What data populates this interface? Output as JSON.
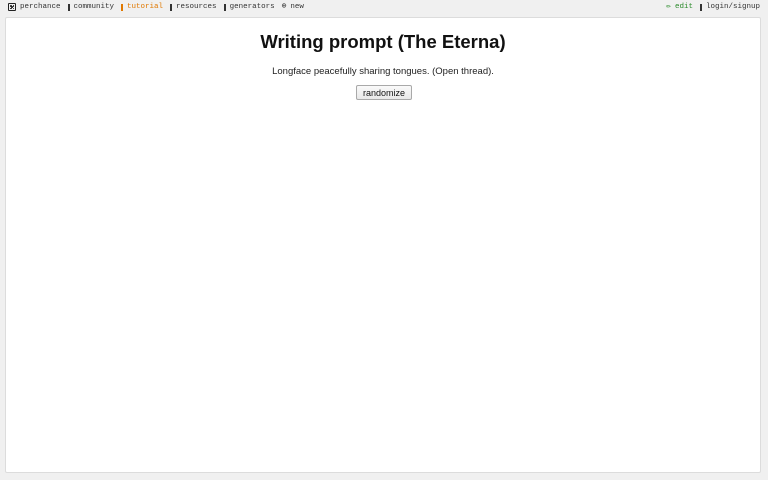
{
  "nav": {
    "items": [
      {
        "label": "perchance",
        "icon": "dice-icon"
      },
      {
        "label": "community",
        "icon": "community-icon"
      },
      {
        "label": "tutorial",
        "icon": "tutorial-icon"
      },
      {
        "label": "resources",
        "icon": "resources-icon"
      },
      {
        "label": "generators",
        "icon": "generators-icon"
      },
      {
        "label": "new",
        "icon": "plus-circle-icon"
      }
    ],
    "edit_label": "edit",
    "edit_icon": "pencil-icon",
    "login_label": "login/signup",
    "login_icon": "user-icon"
  },
  "colors": {
    "tutorial": "#e07800",
    "edit": "#2a8a2a",
    "background": "#f0f0f0",
    "panel": "#ffffff"
  },
  "main": {
    "title": "Writing prompt (The Eterna)",
    "prompt": "Longface peacefully sharing tongues. (Open thread).",
    "randomize_label": "randomize"
  }
}
